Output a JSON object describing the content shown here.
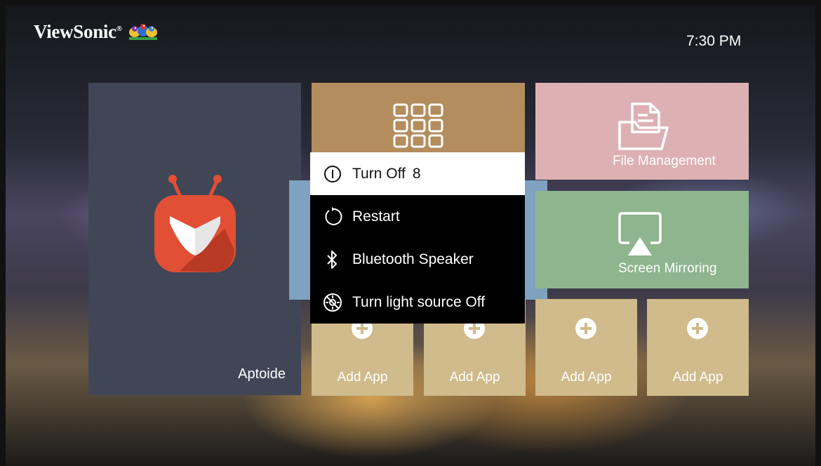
{
  "header": {
    "brand": "ViewSonic",
    "clock": "7:30 PM"
  },
  "tiles": {
    "aptoide": {
      "label": "Aptoide"
    },
    "file_management": {
      "label": "File Management"
    },
    "screen_mirroring": {
      "label": "Screen Mirroring"
    },
    "add_app": [
      {
        "label": "Add App"
      },
      {
        "label": "Add App"
      },
      {
        "label": "Add App"
      },
      {
        "label": "Add App"
      }
    ]
  },
  "power_menu": {
    "items": [
      {
        "label": "Turn Off",
        "countdown": "8",
        "icon": "power-icon",
        "selected": true
      },
      {
        "label": "Restart",
        "icon": "restart-icon"
      },
      {
        "label": "Bluetooth Speaker",
        "icon": "bluetooth-icon"
      },
      {
        "label": "Turn light source Off",
        "icon": "light-off-icon"
      }
    ]
  },
  "colors": {
    "aptoide_tile": "#404656",
    "apps_tile": "#b38d5e",
    "file_tile": "#ddb1b4",
    "mirror_tile": "#8eb58d",
    "add_tile": "#cfbb8b",
    "aptoide_red": "#e14f35"
  }
}
